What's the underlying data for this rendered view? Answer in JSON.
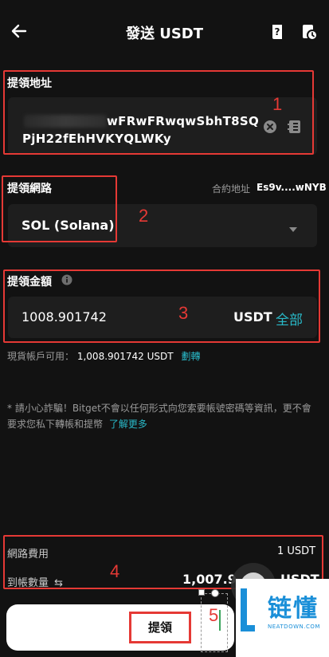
{
  "header": {
    "title": "發送 USDT"
  },
  "address_section": {
    "label": "提領地址",
    "line1": "wFRwFRwqwSbhT8SQ",
    "line2": "PjH22fEhHVKYQLWKy",
    "annotation": "1"
  },
  "network_section": {
    "label": "提領網路",
    "contract_label": "合約地址",
    "contract_value": "Es9v....wNYB",
    "selected": "SOL (Solana)",
    "annotation": "2"
  },
  "amount_section": {
    "label": "提領金額",
    "value": "1008.901742",
    "currency": "USDT",
    "all_label": "全部",
    "annotation": "3",
    "balance_label": "現貨帳戶可用：",
    "balance_value": "1,008.901742 USDT",
    "transfer_link": "劃轉"
  },
  "warning": {
    "text": "* 請小心詐騙！Bitget不會以任何形式向您索要帳號密碼等資訊，更不會要求您私下轉帳和提幣",
    "link": "了解更多"
  },
  "fee_section": {
    "fee_label": "網路費用",
    "fee_value": "1 USDT",
    "received_label": "到帳數量",
    "received_value": "1,007.9",
    "received_unit": "USDT",
    "annotation": "4"
  },
  "bottom": {
    "withdraw_label": "提領",
    "annotation": "5"
  },
  "watermark": {
    "cn": "链懂",
    "en": "NEATDOWN.COM"
  }
}
